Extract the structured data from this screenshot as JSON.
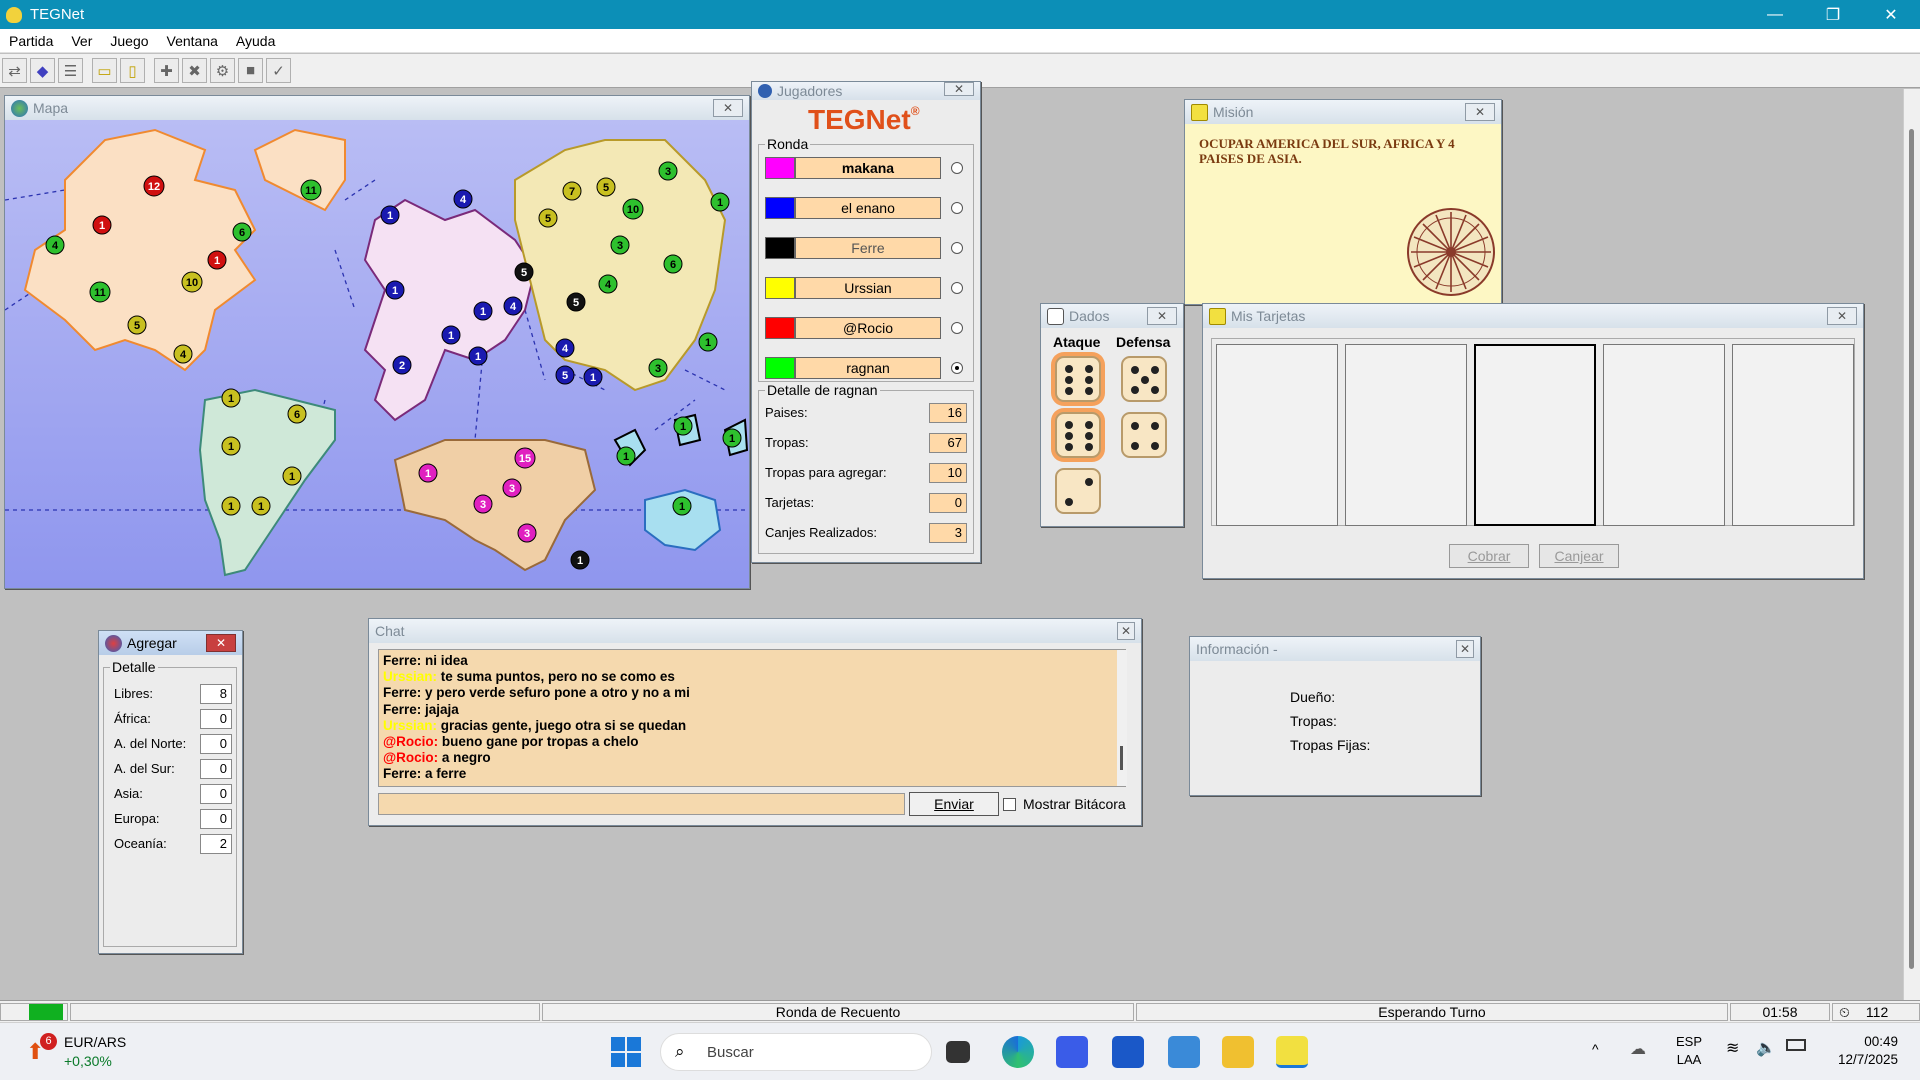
{
  "window": {
    "title": "TEGNet",
    "minimize": "—",
    "restore": "❐",
    "close": "✕"
  },
  "menu": [
    "Partida",
    "Ver",
    "Juego",
    "Ventana",
    "Ayuda"
  ],
  "toolbar": {
    "icons": [
      "connect-icon",
      "server-icon",
      "list-icon",
      "card-icon",
      "mission-icon",
      "add-icon",
      "cancel-icon",
      "gear-icon",
      "stop-icon",
      "check-icon"
    ]
  },
  "mapa": {
    "title": "Mapa"
  },
  "jugadores": {
    "title": "Jugadores",
    "logo": "TEGNet",
    "logo_mark": "®",
    "ronda_label": "Ronda",
    "players": [
      {
        "name": "makana",
        "color": "#ff00ff",
        "bold": true,
        "selected": false
      },
      {
        "name": "el enano",
        "color": "#0000ff",
        "bold": false,
        "selected": false
      },
      {
        "name": "Ferre",
        "color": "#000000",
        "bold": false,
        "selected": false
      },
      {
        "name": "Urssian",
        "color": "#ffff00",
        "bold": false,
        "selected": false
      },
      {
        "name": "@Rocio",
        "color": "#ff0000",
        "bold": false,
        "selected": false
      },
      {
        "name": "ragnan",
        "color": "#00ff00",
        "bold": false,
        "selected": true
      }
    ],
    "detail_title": "Detalle de ragnan",
    "details": [
      {
        "label": "Paises:",
        "value": "16"
      },
      {
        "label": "Tropas:",
        "value": "67"
      },
      {
        "label": "Tropas para agregar:",
        "value": "10"
      },
      {
        "label": "Tarjetas:",
        "value": "0"
      },
      {
        "label": "Canjes Realizados:",
        "value": "3"
      }
    ]
  },
  "mision": {
    "title": "Misión",
    "text": "OCUPAR AMERICA DEL SUR, AFRICA Y 4 PAISES DE ASIA."
  },
  "dados": {
    "title": "Dados",
    "attack_label": "Ataque",
    "defense_label": "Defensa",
    "attack": [
      6,
      6,
      2
    ],
    "defense": [
      5,
      4
    ]
  },
  "tarjetas": {
    "title": "Mis Tarjetas",
    "cobrar": "Cobrar",
    "canjear": "Canjear"
  },
  "agregar": {
    "title": "Agregar",
    "group": "Detalle",
    "rows": [
      {
        "label": "Libres:",
        "value": "8"
      },
      {
        "label": "África:",
        "value": "0"
      },
      {
        "label": "A. del Norte:",
        "value": "0"
      },
      {
        "label": "A. del Sur:",
        "value": "0"
      },
      {
        "label": "Asia:",
        "value": "0"
      },
      {
        "label": "Europa:",
        "value": "0"
      },
      {
        "label": "Oceanía:",
        "value": "2"
      }
    ]
  },
  "chat": {
    "title": "Chat",
    "lines": [
      {
        "who": "Ferre:",
        "whoColor": "#000",
        "text": " ni idea"
      },
      {
        "who": "Urssian:",
        "whoColor": "#ffff00",
        "text": " te suma puntos, pero no se como es"
      },
      {
        "who": "Ferre:",
        "whoColor": "#000",
        "text": " y pero verde sefuro pone a otro y no a mi"
      },
      {
        "who": "Ferre:",
        "whoColor": "#000",
        "text": " jajaja"
      },
      {
        "who": "Urssian:",
        "whoColor": "#ffff00",
        "text": " gracias gente, juego otra si se quedan"
      },
      {
        "who": "@Rocio:",
        "whoColor": "#ff0000",
        "text": " bueno gane por tropas a chelo"
      },
      {
        "who": "@Rocio:",
        "whoColor": "#ff0000",
        "text": " a negro"
      },
      {
        "who": "Ferre:",
        "whoColor": "#000",
        "text": " a ferre"
      }
    ],
    "send": "Enviar",
    "log_label": "Mostrar Bitácora",
    "input_value": ""
  },
  "info": {
    "title": "Información -",
    "owner": "Dueño:",
    "troops": "Tropas:",
    "fixed": "Tropas Fijas:"
  },
  "status": {
    "round": "Ronda de Recuento",
    "state": "Esperando Turno",
    "time": "01:58",
    "count": "112"
  },
  "taskbar": {
    "widget_badge": "6",
    "widget_title": "EUR/ARS",
    "widget_value": "+0,30%",
    "search": "Buscar",
    "lang1": "ESP",
    "lang2": "LAA",
    "clock": "00:49",
    "date": "12/7/2025"
  }
}
